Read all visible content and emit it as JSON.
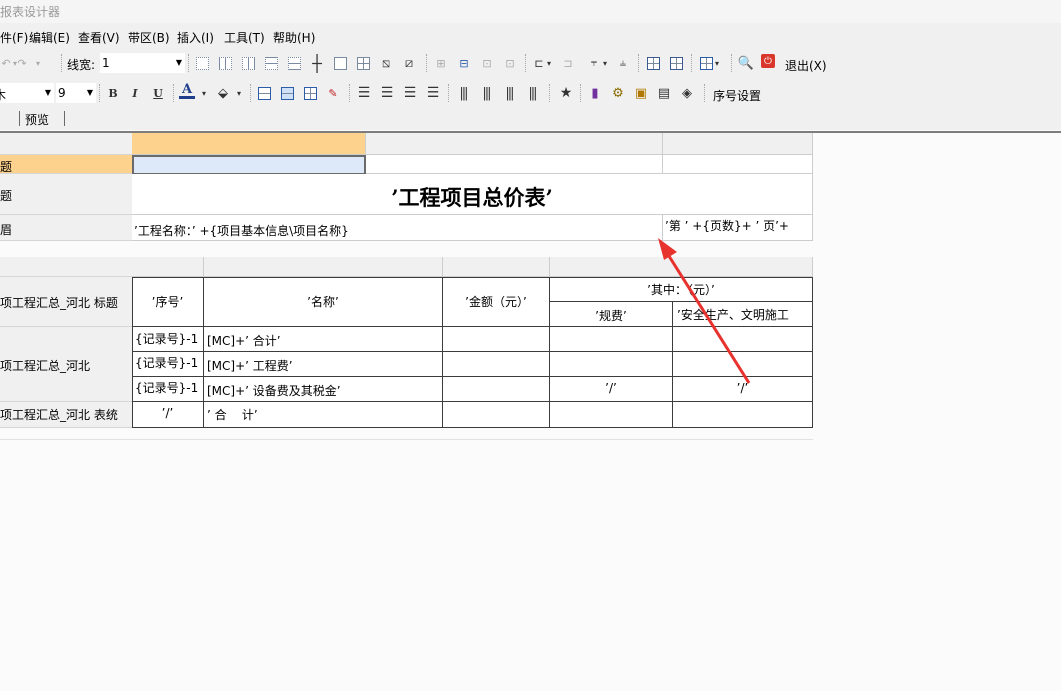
{
  "window": {
    "title": "报表设计器"
  },
  "menu": [
    "件(F)",
    "编辑(E)",
    "查看(V)",
    "带区(B)",
    "插入(I)",
    "工具(T)",
    "帮助(H)"
  ],
  "toolbar1": {
    "linewidth_label": "线宽:",
    "linewidth_value": "1",
    "exit_label": "退出(X)"
  },
  "toolbar2": {
    "font_name": "木",
    "font_size": "9",
    "bold": "B",
    "italic": "I",
    "underline": "U",
    "font_color": "A",
    "seq_setting": "序号设置"
  },
  "tabs": {
    "preview": "预览"
  },
  "bands": {
    "b1": "题",
    "b2": "题",
    "b3": "眉",
    "b4": "项工程汇总_河北 标题",
    "b5": "项工程汇总_河北",
    "b6": "项工程汇总_河北 表统"
  },
  "report": {
    "title": "’工程项目总价表’",
    "project_name": "’工程名称：’ +{项目基本信息\\项目名称}",
    "page_info": "’第 ’ +{页数}+ ’ 页’+",
    "headers": {
      "seq": "’序号’",
      "name": "’名称’",
      "amount": "’金额（元）’",
      "of_which": "’其中：（元）’",
      "fee": "’规费’",
      "safety": "’安全生产、文明施工"
    },
    "rows": [
      {
        "seq": "{记录号}-1",
        "name": "[MC]+’ 合计’",
        "fee": "",
        "safety": ""
      },
      {
        "seq": "{记录号}-1",
        "name": "[MC]+’ 工程费’",
        "fee": "",
        "safety": ""
      },
      {
        "seq": "{记录号}-1",
        "name": "[MC]+’ 设备费及其税金’",
        "fee": "’/’",
        "safety": "’/’"
      }
    ],
    "total": {
      "seq": "’/’",
      "name": "’ 合    计’"
    }
  },
  "colors": {
    "selected_header": "#fdd28c",
    "selected_band": "#fdd28c",
    "selected_cell": "#dde8f8",
    "arrow": "#e8322e"
  }
}
